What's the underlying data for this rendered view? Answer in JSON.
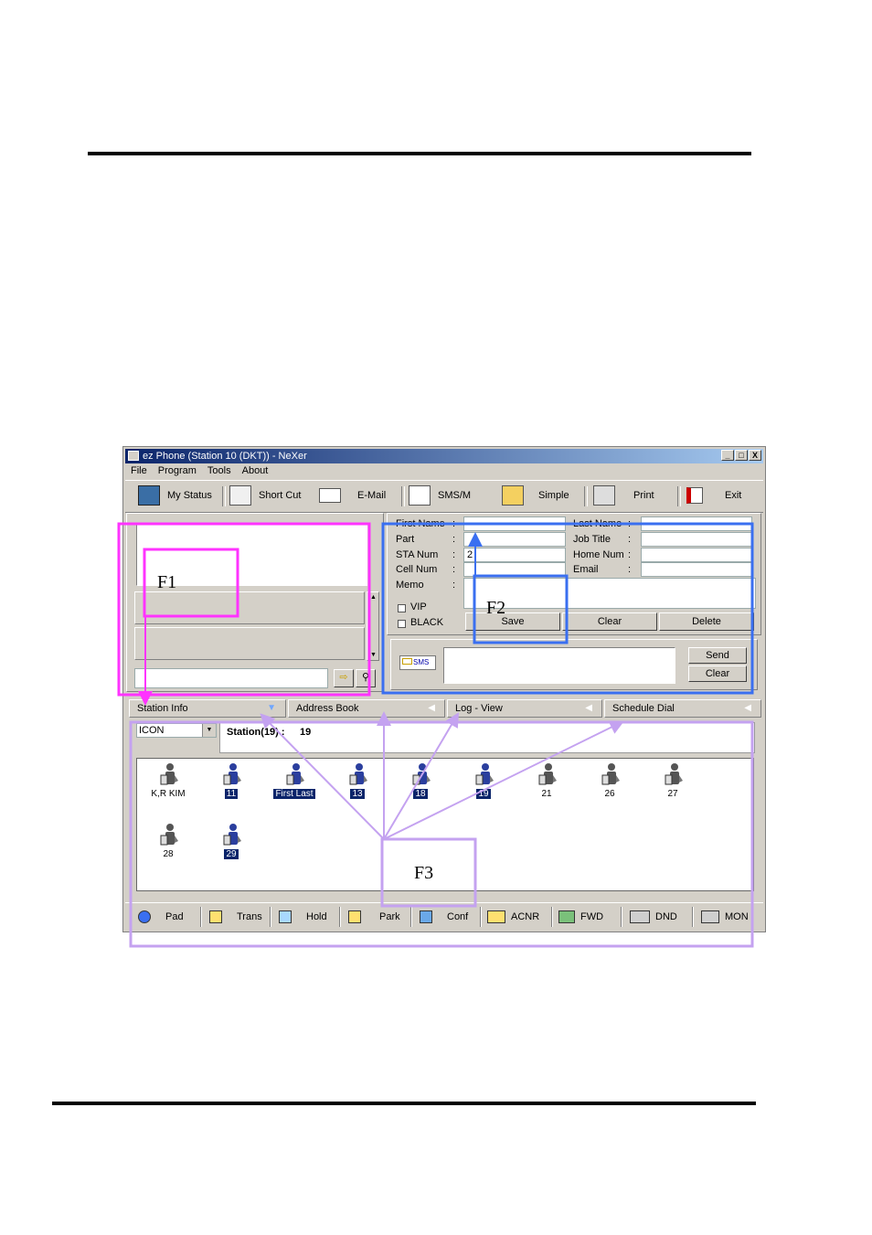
{
  "window": {
    "title": "ez Phone (Station 10 (DKT)) - NeXer",
    "controls": [
      "_",
      "□",
      "X"
    ]
  },
  "menu": [
    "File",
    "Program",
    "Tools",
    "About"
  ],
  "toolbar": {
    "items": [
      {
        "label": "My Status",
        "icon": "monitor-icon"
      },
      {
        "label": "Short Cut",
        "icon": "shortcut-icon"
      },
      {
        "label": "E-Mail",
        "icon": "envelope-icon"
      },
      {
        "label": "SMS/M",
        "icon": "sms-icon"
      },
      {
        "label": "Simple",
        "icon": "simple-icon"
      },
      {
        "label": "Print",
        "icon": "printer-icon"
      },
      {
        "label": "Exit",
        "icon": "exit-icon"
      }
    ]
  },
  "contact": {
    "first_name": "First Name",
    "last_name": "Last Name",
    "part": "Part",
    "job_title": "Job Title",
    "sta_num": "STA Num",
    "home_num": "Home Num",
    "cell_num": "Cell Num",
    "email": "Email",
    "memo": "Memo",
    "colon": ":",
    "sta_num_value": "2",
    "vip": "VIP",
    "black": "BLACK",
    "save": "Save",
    "clear": "Clear",
    "delete": "Delete"
  },
  "sms": {
    "badge": "SMS",
    "send": "Send",
    "clear": "Clear"
  },
  "tabs": [
    "Station Info",
    "Address Book",
    "Log - View",
    "Schedule Dial"
  ],
  "view": {
    "mode": "ICON",
    "station_label": "Station(19) :",
    "station_count": "19"
  },
  "stations": [
    {
      "name": "K,R KIM",
      "selected": false
    },
    {
      "name": "11",
      "selected": true
    },
    {
      "name": "First Last",
      "selected": true
    },
    {
      "name": "13",
      "selected": true
    },
    {
      "name": "18",
      "selected": true
    },
    {
      "name": "19",
      "selected": true
    },
    {
      "name": "21",
      "selected": false
    },
    {
      "name": "26",
      "selected": false
    },
    {
      "name": "27",
      "selected": false
    },
    {
      "name": "28",
      "selected": false
    },
    {
      "name": "29",
      "selected": true
    }
  ],
  "functions": [
    "Pad",
    "Trans",
    "Hold",
    "Park",
    "Conf",
    "ACNR",
    "FWD",
    "DND",
    "MON"
  ],
  "annotations": {
    "f1": "F1",
    "f2": "F2",
    "f3": "F3"
  },
  "colors": {
    "f1_box": "#ff33ff",
    "f2_box": "#3a6ff0",
    "f3_box": "#c4a2f0",
    "title_bar": "#0a246a",
    "selected": "#0a246a"
  }
}
